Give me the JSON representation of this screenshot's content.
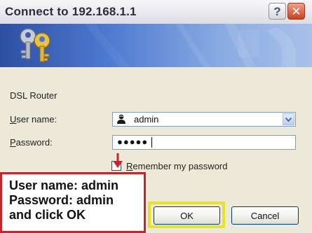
{
  "window": {
    "title": "Connect to 192.168.1.1",
    "help_glyph": "?",
    "close_glyph": "✕"
  },
  "banner": {
    "icon": "keys-icon"
  },
  "site_label": "DSL Router",
  "username": {
    "label_accel": "U",
    "label_rest": "ser name:",
    "value": "admin",
    "icon": "user-icon"
  },
  "password": {
    "label_accel": "P",
    "label_rest": "assword:",
    "masked_value": "●●●●●"
  },
  "remember": {
    "label_accel": "R",
    "label_rest": "emember my password",
    "checked": false
  },
  "buttons": {
    "ok_label": "OK",
    "cancel_label": "Cancel"
  },
  "annotation": {
    "lines": [
      "User name: admin",
      "Password: admin",
      "and click OK"
    ],
    "border_color": "#c0282d",
    "highlight_color": "#e6e22a"
  }
}
